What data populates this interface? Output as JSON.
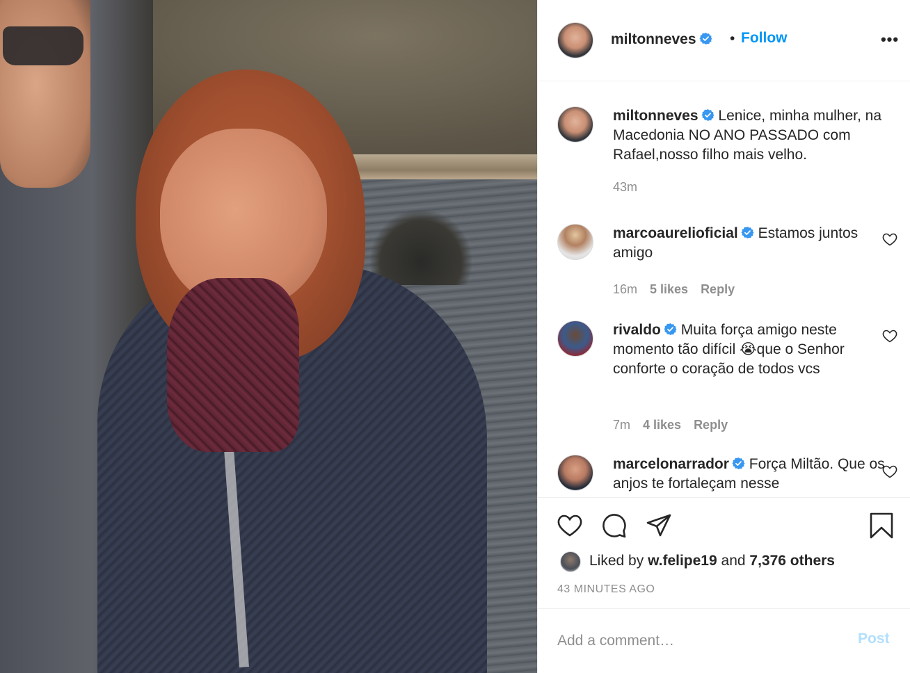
{
  "post": {
    "image_description_icon": "post-photo"
  },
  "header": {
    "username": "miltonneves",
    "dot": "•",
    "follow_label": "Follow",
    "more_label": "•••"
  },
  "caption": {
    "username": "miltonneves",
    "text": "Lenice, minha mulher, na Macedonia NO ANO PASSADO com Rafael,nosso filho mais velho.",
    "time": "43m"
  },
  "comments": [
    {
      "username": "marcoaurelioficial",
      "text": "Estamos juntos amigo",
      "time": "16m",
      "likes": "5 likes",
      "reply": "Reply"
    },
    {
      "username": "rivaldo",
      "text_before": "Muita força amigo neste momento tão difícil ",
      "emoji": "😭",
      "text_after": "que o Senhor conforte o coração de todos vcs",
      "time": "7m",
      "likes": "4 likes",
      "reply": "Reply"
    },
    {
      "username": "marcelonarrador",
      "text": "Força Miltão. Que os anjos te fortaleçam nesse"
    }
  ],
  "likes": {
    "prefix": "Liked by",
    "user": "w.felipe19",
    "conj": "and",
    "others": "7,376 others"
  },
  "timestamp": "43 MINUTES AGO",
  "add_comment": {
    "placeholder": "Add a comment…",
    "post_label": "Post"
  },
  "colors": {
    "accent": "#0095f6",
    "verified": "#3897f0",
    "muted": "#8e8e8e",
    "post_disabled": "#b2dffc"
  }
}
